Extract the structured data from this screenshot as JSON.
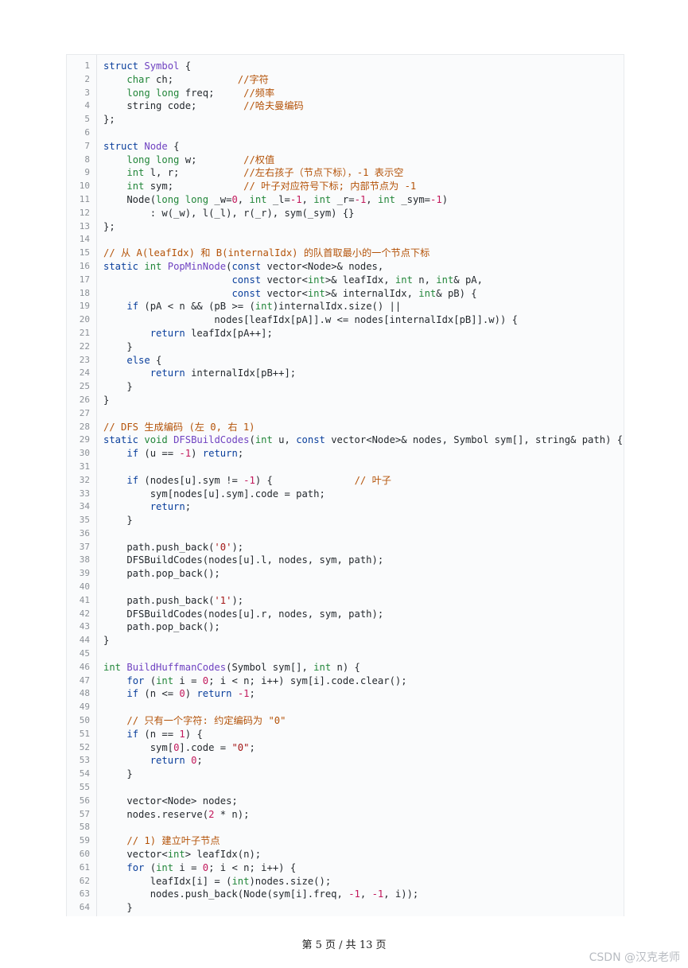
{
  "code_lines": [
    {
      "n": "1",
      "html": "<span class=\"kw\">struct</span> <span class=\"fn\">Symbol</span> {"
    },
    {
      "n": "2",
      "html": "    <span class=\"tp\">char</span> ch;           <span class=\"cm\">//字符</span>"
    },
    {
      "n": "3",
      "html": "    <span class=\"tp\">long long</span> freq;     <span class=\"cm\">//频率</span>"
    },
    {
      "n": "4",
      "html": "    string code;        <span class=\"cm\">//哈夫曼编码</span>"
    },
    {
      "n": "5",
      "html": "};"
    },
    {
      "n": "6",
      "html": ""
    },
    {
      "n": "7",
      "html": "<span class=\"kw\">struct</span> <span class=\"fn\">Node</span> {"
    },
    {
      "n": "8",
      "html": "    <span class=\"tp\">long long</span> w;        <span class=\"cm\">//权值</span>"
    },
    {
      "n": "9",
      "html": "    <span class=\"tp\">int</span> l, r;           <span class=\"cm\">//左右孩子（节点下标），-1 表示空</span>"
    },
    {
      "n": "10",
      "html": "    <span class=\"tp\">int</span> sym;            <span class=\"cm\">// 叶子对应符号下标; 内部节点为 -1</span>"
    },
    {
      "n": "11",
      "html": "    Node(<span class=\"tp\">long long</span> _w=<span class=\"num\">0</span>, <span class=\"tp\">int</span> _l=<span class=\"num\">-1</span>, <span class=\"tp\">int</span> _r=<span class=\"num\">-1</span>, <span class=\"tp\">int</span> _sym=<span class=\"num\">-1</span>)"
    },
    {
      "n": "12",
      "html": "        : w(_w), l(_l), r(_r), sym(_sym) {}"
    },
    {
      "n": "13",
      "html": "};"
    },
    {
      "n": "14",
      "html": ""
    },
    {
      "n": "15",
      "html": "<span class=\"cm\">// 从 A(leafIdx) 和 B(internalIdx) 的队首取最小的一个节点下标</span>"
    },
    {
      "n": "16",
      "html": "<span class=\"kw\">static</span> <span class=\"tp\">int</span> <span class=\"fn\">PopMinNode</span>(<span class=\"kw\">const</span> vector&lt;Node&gt;&amp; nodes,"
    },
    {
      "n": "17",
      "html": "                      <span class=\"kw\">const</span> vector&lt;<span class=\"tp\">int</span>&gt;&amp; leafIdx, <span class=\"tp\">int</span> n, <span class=\"tp\">int</span>&amp; pA,"
    },
    {
      "n": "18",
      "html": "                      <span class=\"kw\">const</span> vector&lt;<span class=\"tp\">int</span>&gt;&amp; internalIdx, <span class=\"tp\">int</span>&amp; pB) {"
    },
    {
      "n": "19",
      "html": "    <span class=\"kw\">if</span> (pA &lt; n &amp;&amp; (pB &gt;= (<span class=\"tp\">int</span>)internalIdx.size() ||"
    },
    {
      "n": "20",
      "html": "                   nodes[leafIdx[pA]].w &lt;= nodes[internalIdx[pB]].w)) {"
    },
    {
      "n": "21",
      "html": "        <span class=\"kw\">return</span> leafIdx[pA++];"
    },
    {
      "n": "22",
      "html": "    }"
    },
    {
      "n": "23",
      "html": "    <span class=\"kw\">else</span> {"
    },
    {
      "n": "24",
      "html": "        <span class=\"kw\">return</span> internalIdx[pB++];"
    },
    {
      "n": "25",
      "html": "    }"
    },
    {
      "n": "26",
      "html": "}"
    },
    {
      "n": "27",
      "html": ""
    },
    {
      "n": "28",
      "html": "<span class=\"cm\">// DFS 生成编码 (左 0, 右 1)</span>"
    },
    {
      "n": "29",
      "html": "<span class=\"kw\">static</span> <span class=\"tp\">void</span> <span class=\"fn\">DFSBuildCodes</span>(<span class=\"tp\">int</span> u, <span class=\"kw\">const</span> vector&lt;Node&gt;&amp; nodes, Symbol sym[], string&amp; path) {"
    },
    {
      "n": "30",
      "html": "    <span class=\"kw\">if</span> (u == <span class=\"num\">-1</span>) <span class=\"kw\">return</span>;"
    },
    {
      "n": "31",
      "html": ""
    },
    {
      "n": "32",
      "html": "    <span class=\"kw\">if</span> (nodes[u].sym != <span class=\"num\">-1</span>) {              <span class=\"cm\">// 叶子</span>"
    },
    {
      "n": "33",
      "html": "        sym[nodes[u].sym].code = path;"
    },
    {
      "n": "34",
      "html": "        <span class=\"kw\">return</span>;"
    },
    {
      "n": "35",
      "html": "    }"
    },
    {
      "n": "36",
      "html": ""
    },
    {
      "n": "37",
      "html": "    path.push_back(<span class=\"str\">'0'</span>);"
    },
    {
      "n": "38",
      "html": "    DFSBuildCodes(nodes[u].l, nodes, sym, path);"
    },
    {
      "n": "39",
      "html": "    path.pop_back();"
    },
    {
      "n": "40",
      "html": ""
    },
    {
      "n": "41",
      "html": "    path.push_back(<span class=\"str\">'1'</span>);"
    },
    {
      "n": "42",
      "html": "    DFSBuildCodes(nodes[u].r, nodes, sym, path);"
    },
    {
      "n": "43",
      "html": "    path.pop_back();"
    },
    {
      "n": "44",
      "html": "}"
    },
    {
      "n": "45",
      "html": ""
    },
    {
      "n": "46",
      "html": "<span class=\"tp\">int</span> <span class=\"fn\">BuildHuffmanCodes</span>(Symbol sym[], <span class=\"tp\">int</span> n) {"
    },
    {
      "n": "47",
      "html": "    <span class=\"kw\">for</span> (<span class=\"tp\">int</span> i = <span class=\"num\">0</span>; i &lt; n; i++) sym[i].code.clear();"
    },
    {
      "n": "48",
      "html": "    <span class=\"kw\">if</span> (n &lt;= <span class=\"num\">0</span>) <span class=\"kw\">return</span> <span class=\"num\">-1</span>;"
    },
    {
      "n": "49",
      "html": ""
    },
    {
      "n": "50",
      "html": "    <span class=\"cm\">// 只有一个字符: 约定编码为 \"0\"</span>"
    },
    {
      "n": "51",
      "html": "    <span class=\"kw\">if</span> (n == <span class=\"num\">1</span>) {"
    },
    {
      "n": "52",
      "html": "        sym[<span class=\"num\">0</span>].code = <span class=\"str\">\"0\"</span>;"
    },
    {
      "n": "53",
      "html": "        <span class=\"kw\">return</span> <span class=\"num\">0</span>;"
    },
    {
      "n": "54",
      "html": "    }"
    },
    {
      "n": "55",
      "html": ""
    },
    {
      "n": "56",
      "html": "    vector&lt;Node&gt; nodes;"
    },
    {
      "n": "57",
      "html": "    nodes.reserve(<span class=\"num\">2</span> * n);"
    },
    {
      "n": "58",
      "html": ""
    },
    {
      "n": "59",
      "html": "    <span class=\"cm\">// 1) 建立叶子节点</span>"
    },
    {
      "n": "60",
      "html": "    vector&lt;<span class=\"tp\">int</span>&gt; leafIdx(n);"
    },
    {
      "n": "61",
      "html": "    <span class=\"kw\">for</span> (<span class=\"tp\">int</span> i = <span class=\"num\">0</span>; i &lt; n; i++) {"
    },
    {
      "n": "62",
      "html": "        leafIdx[i] = (<span class=\"tp\">int</span>)nodes.size();"
    },
    {
      "n": "63",
      "html": "        nodes.push_back(Node(sym[i].freq, <span class=\"num\">-1</span>, <span class=\"num\">-1</span>, i));"
    },
    {
      "n": "64",
      "html": "    }"
    }
  ],
  "footer": {
    "page_label": "第 5 页 / 共 13 页"
  },
  "watermark": "CSDN @汉克老师"
}
